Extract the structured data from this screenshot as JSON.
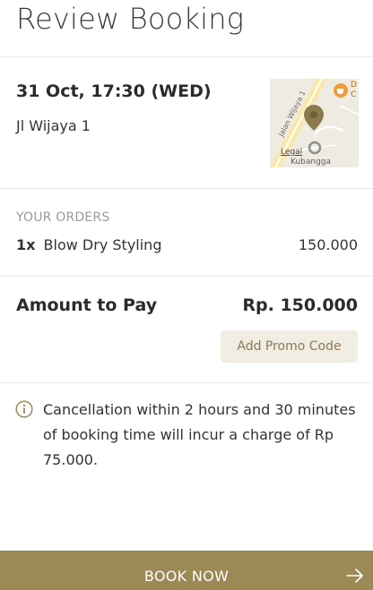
{
  "header": {
    "title": "Review Booking"
  },
  "booking": {
    "datetime": "31 Oct, 17:30 (WED)",
    "address": "Jl Wijaya 1",
    "map": {
      "street_label": "Jalan Wijaya 1",
      "area_label": "Kubangga",
      "legal_label": "Legal",
      "poi_label_line1": "D",
      "poi_label_line2": "C",
      "pin_color": "#8a7a4e"
    }
  },
  "orders": {
    "caption": "YOUR ORDERS",
    "items": [
      {
        "qty": "1x",
        "name": "Blow Dry Styling",
        "price": "150.000"
      }
    ]
  },
  "payment": {
    "label": "Amount to Pay",
    "amount": "Rp. 150.000",
    "promo_button": "Add Promo Code"
  },
  "notice": {
    "text": "Cancellation within 2 hours and 30 minutes of booking time will incur a charge of Rp 75.000."
  },
  "footer": {
    "book_button": "BOOK NOW",
    "accent_color": "#9b8a55"
  }
}
